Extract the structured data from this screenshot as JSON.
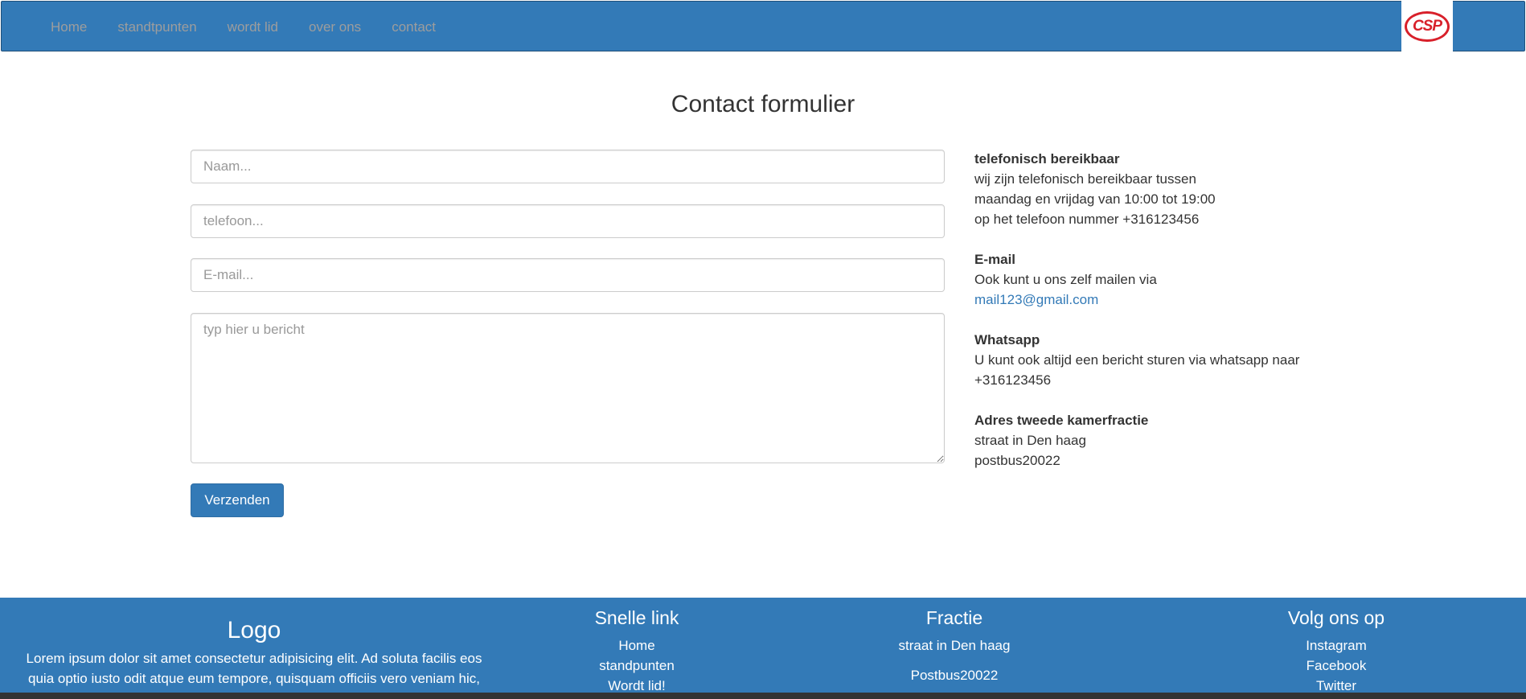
{
  "nav": {
    "items": [
      {
        "label": "Home"
      },
      {
        "label": "standtpunten"
      },
      {
        "label": "wordt lid"
      },
      {
        "label": "over ons"
      },
      {
        "label": "contact"
      }
    ],
    "logo_text": "CSP"
  },
  "page": {
    "title": "Contact formulier"
  },
  "form": {
    "name_placeholder": "Naam...",
    "phone_placeholder": "telefoon...",
    "email_placeholder": "E-mail...",
    "message_placeholder": "typ hier u bericht",
    "submit_label": "Verzenden"
  },
  "info": {
    "phone": {
      "heading": "telefonisch bereikbaar",
      "lines": [
        "wij zijn telefonisch bereikbaar tussen",
        "maandag en vrijdag van 10:00 tot 19:00",
        "op het telefoon nummer +316123456"
      ]
    },
    "email": {
      "heading": "E-mail",
      "line": "Ook kunt u ons zelf mailen via",
      "link": "mail123@gmail.com"
    },
    "whatsapp": {
      "heading": "Whatsapp",
      "lines": [
        "U kunt ook altijd een bericht sturen via whatsapp naar",
        "+316123456"
      ]
    },
    "address": {
      "heading": "Adres tweede kamerfractie",
      "lines": [
        "straat in Den haag",
        "postbus20022"
      ]
    }
  },
  "footer": {
    "logo_title": "Logo",
    "logo_text_lines": [
      "Lorem ipsum dolor sit amet consectetur adipisicing elit. Ad soluta facilis eos",
      "quia optio iusto odit atque eum tempore, quisquam officiis vero veniam hic,"
    ],
    "quick_links": {
      "title": "Snelle link",
      "items": [
        "Home",
        "standpunten",
        "Wordt lid!"
      ]
    },
    "fractie": {
      "title": "Fractie",
      "items": [
        "straat in Den haag",
        "Postbus20022"
      ]
    },
    "social": {
      "title": "Volg ons op",
      "items": [
        "Instagram",
        "Facebook",
        "Twitter"
      ]
    }
  },
  "colors": {
    "primary": "#337ab7",
    "logo_red": "#d8202a"
  }
}
